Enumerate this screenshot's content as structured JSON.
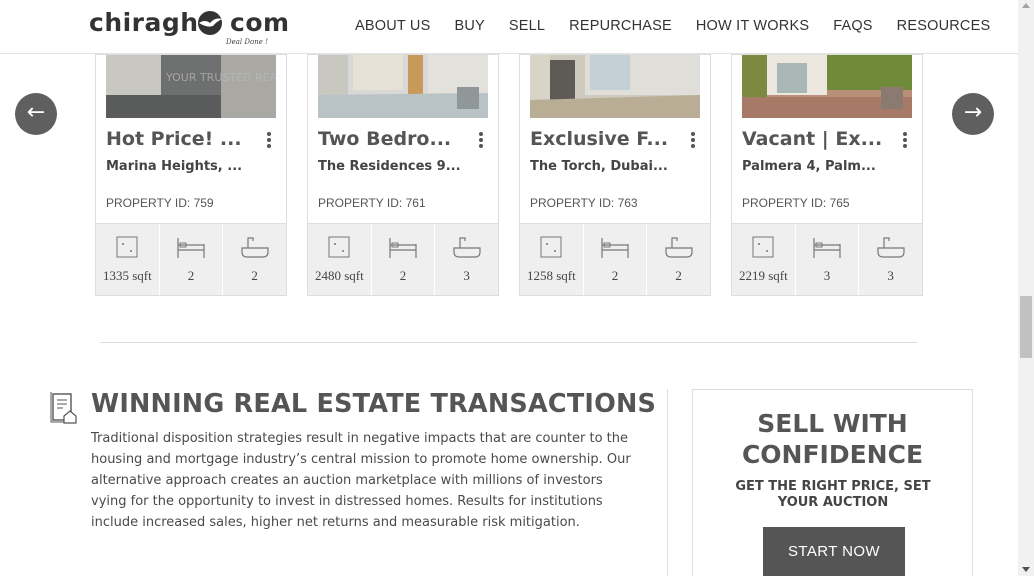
{
  "header": {
    "logo_left": "chiragh",
    "logo_right": "com",
    "logo_tagline": "Deal Done !",
    "nav": [
      "ABOUT US",
      "BUY",
      "SELL",
      "REPURCHASE",
      "HOW IT WORKS",
      "FAQS",
      "RESOURCES"
    ]
  },
  "carousel": {
    "prev_label": "←",
    "next_label": "→",
    "cards": [
      {
        "title": "Hot Price! ...",
        "location": "Marina Heights, ...",
        "property_id": "PROPERTY ID: 759",
        "area": "1335 sqft",
        "beds": "2",
        "baths": "2"
      },
      {
        "title": "Two Bedro...",
        "location": "The Residences 9...",
        "property_id": "PROPERTY ID: 761",
        "area": "2480 sqft",
        "beds": "2",
        "baths": "3"
      },
      {
        "title": "Exclusive F...",
        "location": "The Torch, Dubai...",
        "property_id": "PROPERTY ID: 763",
        "area": "1258 sqft",
        "beds": "2",
        "baths": "2"
      },
      {
        "title": "Vacant | Ex...",
        "location": "Palmera 4, Palm...",
        "property_id": "PROPERTY ID: 765",
        "area": "2219 sqft",
        "beds": "3",
        "baths": "3"
      }
    ]
  },
  "winning": {
    "title": "WINNING REAL ESTATE TRANSACTIONS",
    "body": "Traditional disposition strategies result in negative impacts that are counter to the housing and mortgage industry’s central mission to promote home ownership. Our alternative approach creates an auction marketplace with millions of investors vying for the opportunity to invest in distressed homes. Results for institutions include increased sales, higher net returns and measurable risk mitigation."
  },
  "sell": {
    "title_line1": "SELL WITH",
    "title_line2": "CONFIDENCE",
    "subtitle": "GET THE RIGHT PRICE, SET YOUR AUCTION",
    "button": "START NOW"
  },
  "colors": {
    "accent_dark": "#555555",
    "arrow_bg": "#5f5f5f",
    "stats_bg": "#efefef"
  }
}
